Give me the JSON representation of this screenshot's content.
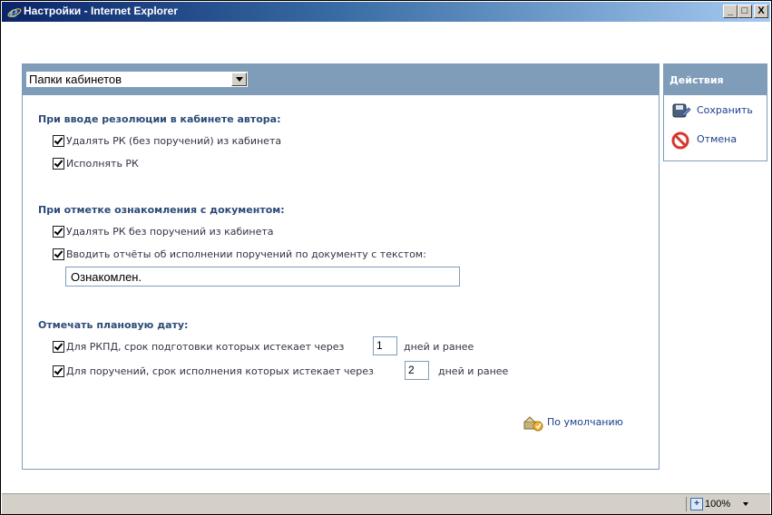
{
  "window": {
    "title": "Настройки - Internet Explorer",
    "minimize_label": "_",
    "maximize_label": "□",
    "close_label": "X"
  },
  "panel": {
    "folder_select_value": "Папки кабинетов",
    "section1": {
      "title": "При вводе резолюции в кабинете автора:",
      "options": [
        {
          "label": "Удалять РК (без поручений) из кабинета",
          "checked": true
        },
        {
          "label": "Исполнять РК",
          "checked": true
        }
      ]
    },
    "section2": {
      "title": "При отметке ознакомления с документом:",
      "options": [
        {
          "label": "Удалять РК без поручений из кабинета",
          "checked": true
        },
        {
          "label": "Вводить отчёты об исполнении поручений по документу с текстом:",
          "checked": true
        }
      ],
      "report_text": "Ознакомлен."
    },
    "section3": {
      "title": "Отмечать плановую дату:",
      "rkpd": {
        "label_before": "Для РКПД, срок подготовки которых истекает через",
        "days": "1",
        "label_after": "дней и ранее",
        "checked": true
      },
      "orders": {
        "label_before": "Для поручений, срок исполнения которых истекает через",
        "days": "2",
        "label_after": "дней и ранее",
        "checked": true
      }
    },
    "default_link": "По умолчанию"
  },
  "actions": {
    "title": "Действия",
    "save_label": "Сохранить",
    "cancel_label": "Отмена"
  },
  "statusbar": {
    "zoom_label": "100%"
  },
  "colors": {
    "header_blue": "#7f9db9",
    "section_title": "#2b4b78",
    "link": "#1c3f8c"
  }
}
